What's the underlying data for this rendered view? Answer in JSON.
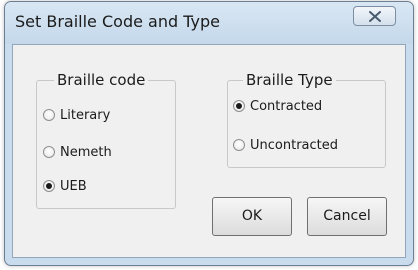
{
  "window": {
    "title": "Set Braille Code and Type"
  },
  "braille_code": {
    "legend": "Braille code",
    "options": [
      {
        "label": "Literary",
        "selected": false
      },
      {
        "label": "Nemeth",
        "selected": false
      },
      {
        "label": "UEB",
        "selected": true
      }
    ]
  },
  "braille_type": {
    "legend": "Braille Type",
    "options": [
      {
        "label": "Contracted",
        "selected": true
      },
      {
        "label": "Uncontracted",
        "selected": false
      }
    ]
  },
  "buttons": {
    "ok": "OK",
    "cancel": "Cancel"
  },
  "icons": {
    "close": "close-icon",
    "radio_dot": "radio-selected-dot"
  }
}
